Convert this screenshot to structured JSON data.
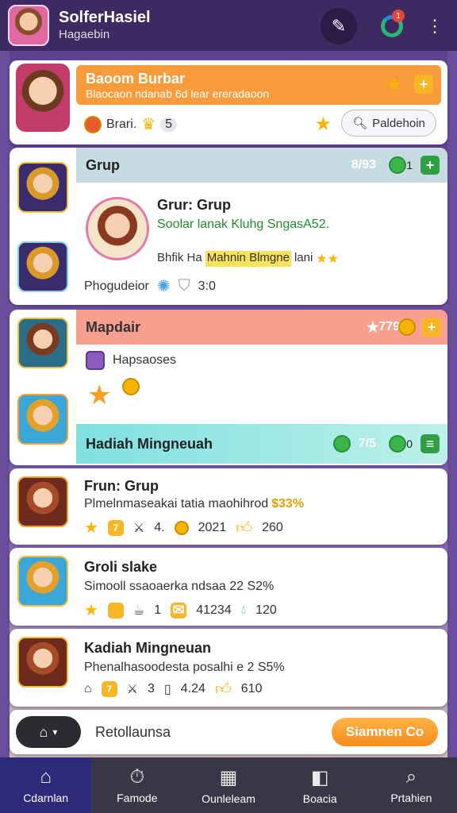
{
  "header": {
    "title": "SolferHasiel",
    "subtitle": "Hagaebin",
    "notif_count": "1"
  },
  "card1": {
    "band_title": "Baoom Burbar",
    "band_sub": "Blaocaon ndanab 6d lear ereradaoon",
    "user_label": "Brari.",
    "count": "5",
    "search_label": "Paldehoin"
  },
  "card2": {
    "band_title": "Grup",
    "band_right": "8/93",
    "band_right2": "1",
    "title": "Grur: Grup",
    "line1": "Soolar lanak Kluhg SngasA52.",
    "line2": "Bhfik Ha",
    "line2b": "Mahnin Blmgne",
    "line2c": "lani",
    "footer": "Phogudeior",
    "footer_val": "3:0"
  },
  "card3": {
    "band_title": "Mapdair",
    "band_right": "779",
    "item1": "Hapsaoses"
  },
  "card4": {
    "band_title": "Hadiah Mingneuah",
    "band_right": "7/5",
    "band_right2": "0"
  },
  "card5": {
    "title": "Frun: Grup",
    "desc": "Plmelnmaseakai tatia maohihrod",
    "pct": "$33%",
    "s1": "4.",
    "s2": "2021",
    "s3": "260"
  },
  "card6": {
    "title": "Groli slake",
    "desc": "Simooll ssaoaerka ndsaa 22 S2%",
    "s1": "1",
    "s2": "41234",
    "s3": "120"
  },
  "card7": {
    "title": "Kadiah Mingneuan",
    "desc": "Phenalhasoodesta posalhi e 2 S5%",
    "s1": "3",
    "s2": "4.24",
    "s3": "610"
  },
  "bottom": {
    "label": "Retollaunsa",
    "cta": "Siamnen Co"
  },
  "nav": [
    {
      "label": "Cdarnlan",
      "icon": "home-icon"
    },
    {
      "label": "Famode",
      "icon": "timer-icon"
    },
    {
      "label": "Ounleleam",
      "icon": "chart-icon"
    },
    {
      "label": "Boacia",
      "icon": "bag-icon"
    },
    {
      "label": "Prtahien",
      "icon": "search-icon"
    }
  ]
}
